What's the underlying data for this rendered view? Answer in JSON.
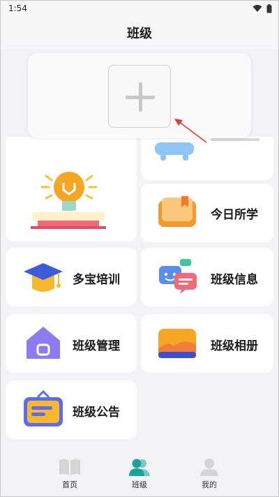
{
  "status": {
    "time": "1:54",
    "wifi_icon": "wifi-icon",
    "battery_icon": "battery-icon"
  },
  "header": {
    "title": "班级"
  },
  "popup": {
    "add_icon": "plus-icon"
  },
  "cards": [
    {
      "id": "today",
      "label": "今日所学",
      "icon": "book-icon"
    },
    {
      "id": "training",
      "label": "多宝培训",
      "icon": "graduation-cap-icon"
    },
    {
      "id": "info",
      "label": "班级信息",
      "icon": "chat-bubbles-icon"
    },
    {
      "id": "manage",
      "label": "班级管理",
      "icon": "house-icon"
    },
    {
      "id": "album",
      "label": "班级相册",
      "icon": "landscape-icon"
    },
    {
      "id": "notice",
      "label": "班级公告",
      "icon": "notice-board-icon"
    }
  ],
  "tabbar": {
    "items": [
      {
        "label": "首页",
        "icon": "book-open-icon",
        "active": false
      },
      {
        "label": "班级",
        "icon": "people-icon",
        "active": true
      },
      {
        "label": "我的",
        "icon": "user-icon",
        "active": false
      }
    ]
  },
  "colors": {
    "accent": "#1aa39a",
    "background": "#f3f3f5",
    "card": "#ffffff",
    "arrow": "#e53935"
  }
}
